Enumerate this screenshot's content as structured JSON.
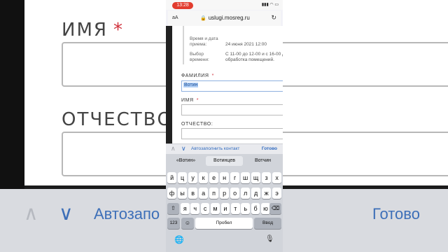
{
  "background": {
    "labels": {
      "name": "ИМЯ",
      "patronymic": "ОТЧЕСТВО:",
      "star": "*"
    },
    "bar": {
      "autofill": "Автозапо",
      "done": "Готово",
      "up": "∧",
      "down": "∨"
    }
  },
  "status_bar": {
    "time": "13:28",
    "icons": "▮▮▮ ◠ ▭"
  },
  "address_bar": {
    "aa": "аА",
    "lock": "🔒",
    "url": "uslugi.mosreg.ru",
    "reload": "↻"
  },
  "form": {
    "info": [
      {
        "key_lines": [
          "Время и дата",
          "приема:"
        ],
        "value_lines": [
          "",
          "24 июня 2021 12:00"
        ]
      },
      {
        "key_lines": [
          "Выбор",
          "времени:"
        ],
        "value_lines": [
          "С 11-00 до 12-00 и с 16-00 до",
          "обработка помещений."
        ]
      }
    ],
    "surname_label": "ФАМИЛИЯ",
    "surname_value": "Вотин",
    "name_label": "ИМЯ",
    "patronymic_label": "ОТЧЕСТВО:",
    "required_mark": "*"
  },
  "accessory": {
    "up": "∧",
    "down": "∨",
    "autofill": "Автозаполнить контакт",
    "done": "Готово"
  },
  "keyboard": {
    "suggestions": [
      "«Вотин»",
      "Вотинцев",
      "Вотчин"
    ],
    "row1": [
      "й",
      "ц",
      "у",
      "к",
      "е",
      "н",
      "г",
      "ш",
      "щ",
      "з",
      "х"
    ],
    "row2": [
      "ф",
      "ы",
      "в",
      "а",
      "п",
      "р",
      "о",
      "л",
      "д",
      "ж",
      "э"
    ],
    "row3": [
      "я",
      "ч",
      "с",
      "м",
      "и",
      "т",
      "ь",
      "б",
      "ю"
    ],
    "shift": "⇧",
    "backspace": "⌫",
    "numbers": "123",
    "emoji": "☺",
    "space": "Пробел",
    "enter": "Ввод",
    "globe": "🌐",
    "mic": "🎙"
  }
}
